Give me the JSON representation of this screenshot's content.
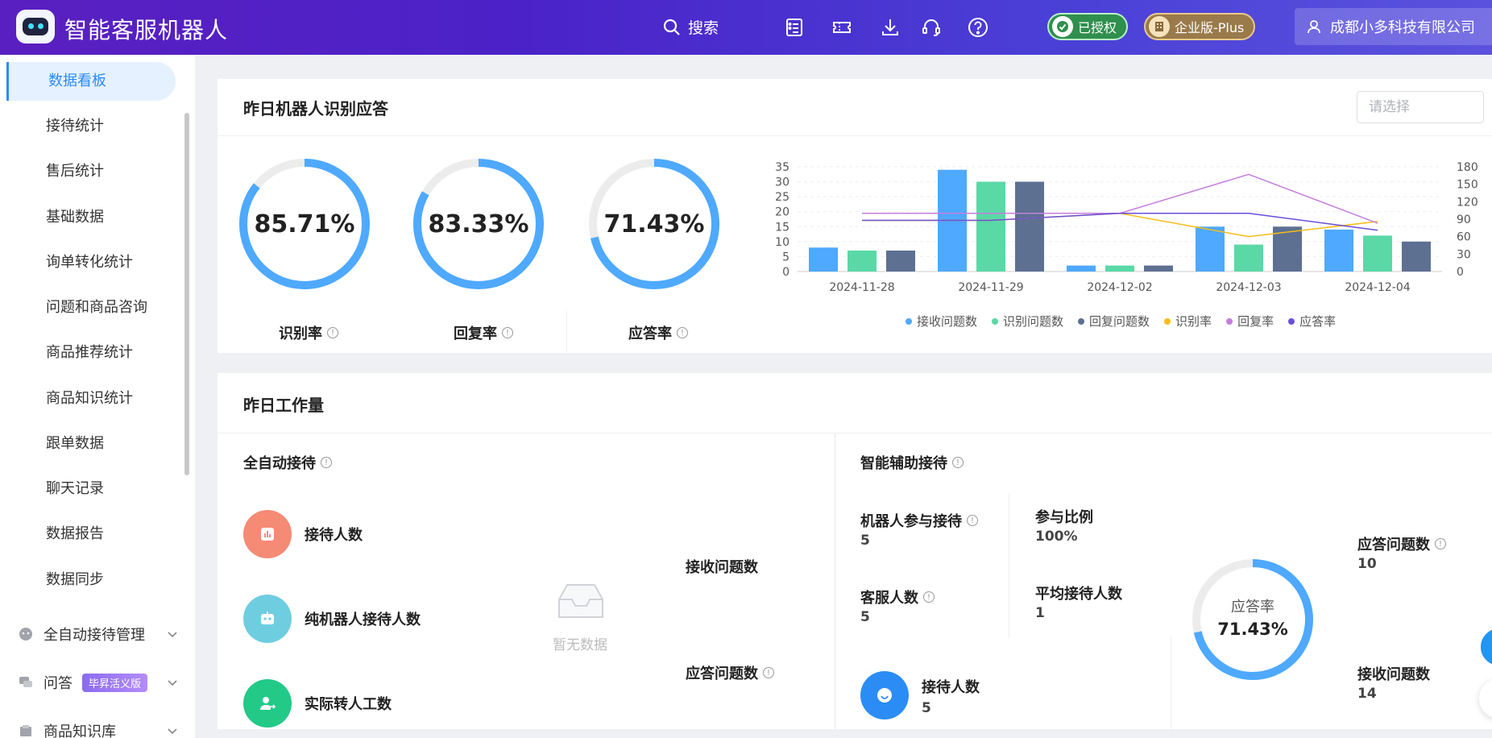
{
  "header": {
    "app_title": "智能客服机器人",
    "search_label": "搜索",
    "auth_badge": "已授权",
    "edition_badge": "企业版-Plus",
    "company": "成都小多科技有限公司"
  },
  "sidebar": {
    "items": [
      {
        "label": "数据看板",
        "active": true
      },
      {
        "label": "接待统计"
      },
      {
        "label": "售后统计"
      },
      {
        "label": "基础数据"
      },
      {
        "label": "询单转化统计"
      },
      {
        "label": "问题和商品咨询"
      },
      {
        "label": "商品推荐统计"
      },
      {
        "label": "商品知识统计"
      },
      {
        "label": "跟单数据"
      },
      {
        "label": "聊天记录"
      },
      {
        "label": "数据报告"
      },
      {
        "label": "数据同步"
      }
    ],
    "groups": [
      {
        "label": "全自动接待管理"
      },
      {
        "label": "问答",
        "tag": "毕昇活义版"
      },
      {
        "label": "商品知识库"
      }
    ]
  },
  "recognition_card": {
    "title": "昨日机器人识别应答",
    "select_placeholder": "请选择",
    "rings": [
      {
        "value": "85.71%",
        "label": "识别率",
        "fraction": 0.8571
      },
      {
        "value": "83.33%",
        "label": "回复率",
        "fraction": 0.8333
      },
      {
        "value": "71.43%",
        "label": "应答率",
        "fraction": 0.7143
      }
    ]
  },
  "chart_data": {
    "type": "bar",
    "categories": [
      "2024-11-28",
      "2024-11-29",
      "2024-12-02",
      "2024-12-03",
      "2024-12-04"
    ],
    "series": [
      {
        "name": "接收问题数",
        "kind": "bar",
        "color": "#4ea9ff",
        "values": [
          8,
          34,
          2,
          15,
          14
        ]
      },
      {
        "name": "识别问题数",
        "kind": "bar",
        "color": "#5ad8a6",
        "values": [
          7,
          30,
          2,
          9,
          12
        ]
      },
      {
        "name": "回复问题数",
        "kind": "bar",
        "color": "#5d7092",
        "values": [
          7,
          30,
          2,
          15,
          10
        ]
      },
      {
        "name": "识别率",
        "kind": "line",
        "axis": "right",
        "color": "#f6bd16",
        "values": [
          88,
          88,
          100,
          60,
          86
        ]
      },
      {
        "name": "回复率",
        "kind": "line",
        "axis": "right",
        "color": "#c57ee0",
        "values": [
          100,
          100,
          100,
          167,
          83
        ]
      },
      {
        "name": "应答率",
        "kind": "line",
        "axis": "right",
        "color": "#6b4fd8",
        "values": [
          88,
          88,
          100,
          100,
          71
        ]
      }
    ],
    "ylim": [
      0,
      35
    ],
    "yticks": [
      0,
      5,
      10,
      15,
      20,
      25,
      30,
      35
    ],
    "y2lim": [
      0,
      180
    ],
    "y2ticks": [
      0,
      30,
      60,
      90,
      120,
      150,
      180
    ],
    "legend_position": "bottom"
  },
  "workload_card": {
    "title": "昨日工作量",
    "auto": {
      "title": "全自动接待",
      "rows": [
        {
          "label": "接待人数",
          "color": "#f58a75"
        },
        {
          "label": "纯机器人接待人数",
          "color": "#6fcde0"
        },
        {
          "label": "实际转人工数",
          "color": "#22c987"
        }
      ],
      "empty_text": "暂无数据",
      "recv_label": "接收问题数",
      "answer_label": "应答问题数"
    },
    "assist": {
      "title": "智能辅助接待",
      "robot_join_label": "机器人参与接待",
      "robot_join_value": "5",
      "cs_count_label": "客服人数",
      "cs_count_value": "5",
      "ratio_label": "参与比例",
      "ratio_value": "100%",
      "avg_label": "平均接待人数",
      "avg_value": "1",
      "reception_label": "接待人数",
      "reception_value": "5",
      "ring_label": "应答率",
      "ring_value": "71.43%",
      "ring_fraction": 0.7143,
      "answer_count_label": "应答问题数",
      "answer_count_value": "10",
      "recv_count_label": "接收问题数",
      "recv_count_value": "14"
    }
  }
}
